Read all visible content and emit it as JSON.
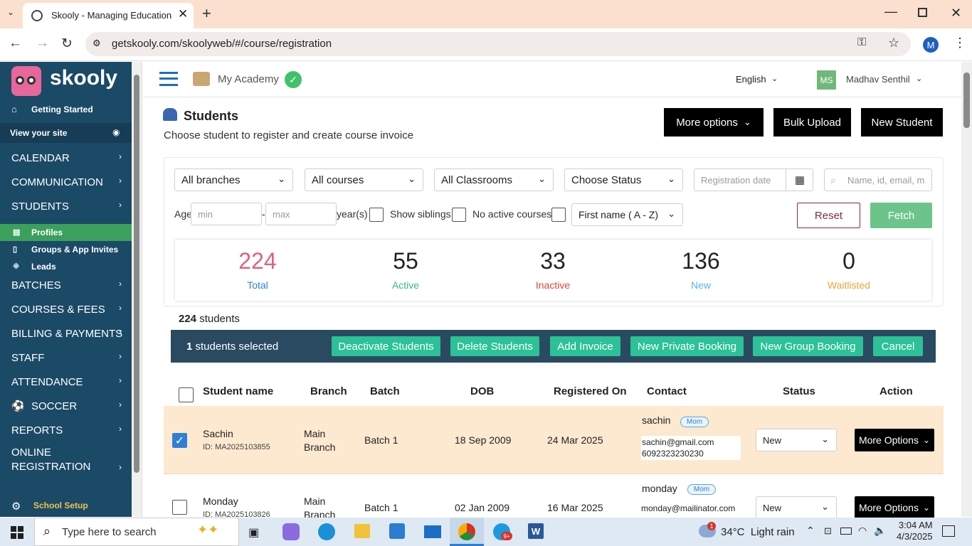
{
  "browser": {
    "tab_title": "Skooly - Managing Educational",
    "url": "getskooly.com/skoolyweb/#/course/registration",
    "profile_initial": "M"
  },
  "sidebar": {
    "logo": "skooly",
    "getting_started": "Getting Started",
    "view_site": "View your site",
    "items": [
      "CALENDAR",
      "COMMUNICATION",
      "STUDENTS"
    ],
    "sub_items": [
      "Profiles",
      "Groups & App Invites",
      "Leads"
    ],
    "items2": [
      "BATCHES",
      "COURSES & FEES",
      "BILLING & PAYMENTS",
      "STAFF",
      "ATTENDANCE",
      "SOCCER",
      "REPORTS"
    ],
    "online_registration_line1": "ONLINE",
    "online_registration_line2": "REGISTRATION",
    "school_setup": "School Setup"
  },
  "header": {
    "academy": "My Academy",
    "language": "English",
    "user_initials": "MS",
    "user_name": "Madhav Senthil"
  },
  "page": {
    "title": "Students",
    "subtitle": "Choose student to register and create course invoice",
    "more_options": "More options",
    "bulk_upload": "Bulk Upload",
    "new_student": "New Student"
  },
  "filters": {
    "branches": "All branches",
    "courses": "All courses",
    "classrooms": "All Classrooms",
    "status": "Choose Status",
    "reg_date_placeholder": "Registration date",
    "search_placeholder": "Name, id, email, m",
    "age_label": "Age",
    "min_placeholder": "min",
    "max_placeholder": "max",
    "dash": "-",
    "years_label": "year(s)",
    "show_siblings": "Show siblings",
    "no_active_courses": "No active courses",
    "sort": "First name ( A - Z)",
    "reset": "Reset",
    "fetch": "Fetch"
  },
  "stats": [
    {
      "value": "224",
      "label": "Total",
      "value_color": "#e0607e",
      "label_color": "#2f7fd8"
    },
    {
      "value": "55",
      "label": "Active",
      "value_color": "#222222",
      "label_color": "#3cb878"
    },
    {
      "value": "33",
      "label": "Inactive",
      "value_color": "#222222",
      "label_color": "#e0443a"
    },
    {
      "value": "136",
      "label": "New",
      "value_color": "#222222",
      "label_color": "#58b4e8"
    },
    {
      "value": "0",
      "label": "Waitlisted",
      "value_color": "#222222",
      "label_color": "#f2a33a"
    }
  ],
  "count": {
    "number": "224",
    "text": "students"
  },
  "selection_bar": {
    "selected_count": "1",
    "selected_text": "students selected",
    "deactivate": "Deactivate Students",
    "delete": "Delete Students",
    "add_invoice": "Add Invoice",
    "private_booking": "New Private Booking",
    "group_booking": "New Group Booking",
    "cancel": "Cancel"
  },
  "table": {
    "headers": [
      "Student name",
      "Branch",
      "Batch",
      "DOB",
      "Registered On",
      "Contact",
      "Status",
      "Action"
    ],
    "rows": [
      {
        "name": "Sachin",
        "id": "ID: MA2025103855",
        "branch1": "Main",
        "branch2": "Branch",
        "batch": "Batch 1",
        "dob": "18 Sep 2009",
        "registered": "24 Mar 2025",
        "contact_name": "sachin",
        "relation": "Mom",
        "email": "sachin@gmail.com",
        "phone": "6092323230230",
        "status": "New",
        "action": "More Options",
        "checked": true
      },
      {
        "name": "Monday",
        "id": "ID: MA2025103826",
        "branch1": "Main",
        "branch2": "Branch",
        "batch": "Batch 1",
        "dob": "02 Jan 2009",
        "registered": "16 Mar 2025",
        "contact_name": "monday",
        "relation": "Mom",
        "email": "monday@mailinator.com",
        "phone": "",
        "status": "New",
        "action": "More Options",
        "checked": false
      }
    ]
  },
  "taskbar": {
    "search_placeholder": "Type here to search",
    "weather": "34°C  Light rain",
    "time": "3:04 AM",
    "date": "4/3/2025",
    "mail_badge": "1",
    "skype_badge": "9+"
  },
  "colors": {
    "sidebar": "#1b4a66",
    "accent_green": "#2cc196",
    "selection_bar": "#2a4a62",
    "selected_row": "#fde9cf"
  }
}
